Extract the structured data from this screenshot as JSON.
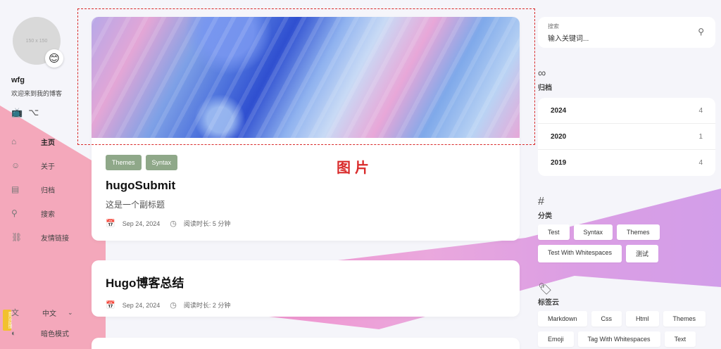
{
  "profile": {
    "avatar_placeholder": "150 x 150",
    "emoji": "😊",
    "name": "wfg",
    "description": "欢迎来到我的博客"
  },
  "social": [
    {
      "icon": "bilibili-icon",
      "glyph": "📺"
    },
    {
      "icon": "github-icon",
      "glyph": "⌥"
    }
  ],
  "menu": [
    {
      "name": "home",
      "label": "主页",
      "glyph": "⌂",
      "active": true
    },
    {
      "name": "about",
      "label": "关于",
      "glyph": "☺",
      "active": false
    },
    {
      "name": "archives",
      "label": "归档",
      "glyph": "▤",
      "active": false
    },
    {
      "name": "search",
      "label": "搜索",
      "glyph": "⚲",
      "active": false
    },
    {
      "name": "links",
      "label": "友情链接",
      "glyph": "⛓",
      "active": false
    }
  ],
  "language": {
    "glyph": "文",
    "label": "中文",
    "chevron": "⌄"
  },
  "dark_mode": {
    "glyph": "◐",
    "label": "暗色模式"
  },
  "feedback": "意见反馈",
  "annotation": "图片",
  "posts": [
    {
      "tags": [
        "Themes",
        "Syntax"
      ],
      "title": "hugoSubmit",
      "subtitle": "这是一个副标题",
      "date": "Sep 24, 2024",
      "reading_time": "阅读时长: 5 分钟"
    },
    {
      "title": "Hugo博客总结",
      "date": "Sep 24, 2024",
      "reading_time": "阅读时长: 2 分钟"
    }
  ],
  "search": {
    "label": "搜索",
    "placeholder": "输入关键词..."
  },
  "archives": {
    "title": "归档",
    "items": [
      {
        "year": "2024",
        "count": "4"
      },
      {
        "year": "2020",
        "count": "1"
      },
      {
        "year": "2019",
        "count": "4"
      }
    ]
  },
  "categories": {
    "title": "分类",
    "items": [
      "Test",
      "Syntax",
      "Themes",
      "Test With Whitespaces",
      "测试"
    ]
  },
  "tag_cloud": {
    "title": "标签云",
    "items": [
      "Markdown",
      "Css",
      "Html",
      "Themes",
      "Emoji",
      "Tag With Whitespaces",
      "Text"
    ]
  },
  "colors": {
    "tag_bg": "#8fa889",
    "annotation": "#d92b2b",
    "background": "#f5f5fa"
  }
}
